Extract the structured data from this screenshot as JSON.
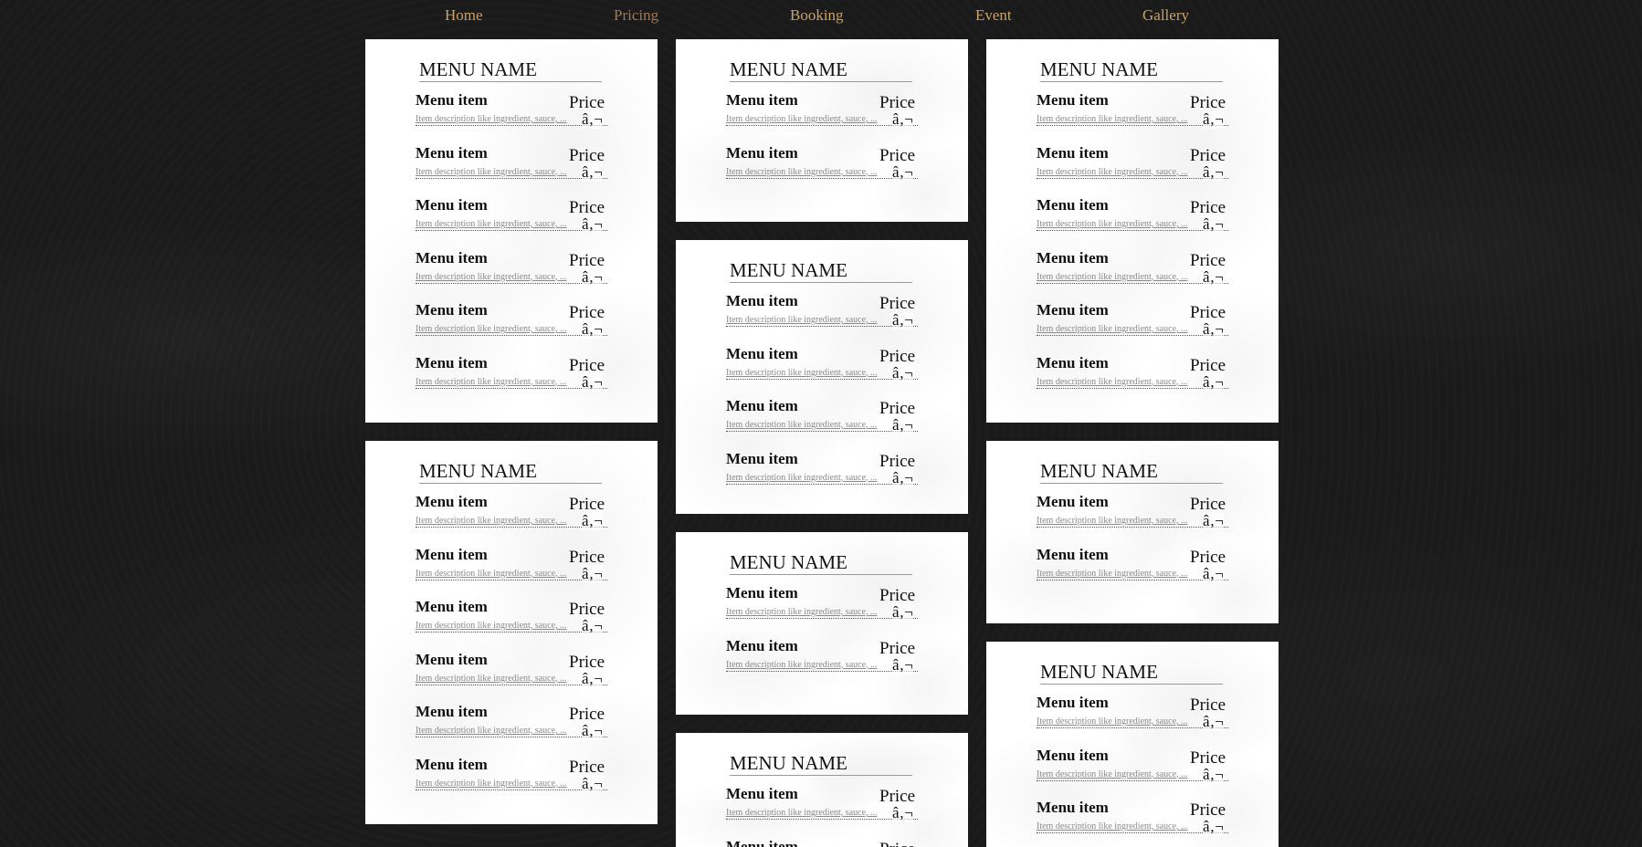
{
  "nav": {
    "items": [
      {
        "label": "Home"
      },
      {
        "label": "Pricing"
      },
      {
        "label": "Booking"
      },
      {
        "label": "Event"
      },
      {
        "label": "Gallery"
      }
    ]
  },
  "menu_item_defaults": {
    "name": "Menu item",
    "price": "Price",
    "description": "Item description like ingredient, sauce, ...",
    "currency": "â‚¬"
  },
  "cards": [
    {
      "title": "MENU NAME",
      "item_count": 6
    },
    {
      "title": "MENU NAME",
      "item_count": 6
    },
    {
      "title": "MENU NAME",
      "item_count": 2
    },
    {
      "title": "MENU NAME",
      "item_count": 4
    },
    {
      "title": "MENU NAME",
      "item_count": 2
    },
    {
      "title": "MENU NAME",
      "item_count": 2
    },
    {
      "title": "MENU NAME",
      "item_count": 6
    },
    {
      "title": "MENU NAME",
      "item_count": 2
    },
    {
      "title": "MENU NAME",
      "item_count": 3
    }
  ]
}
